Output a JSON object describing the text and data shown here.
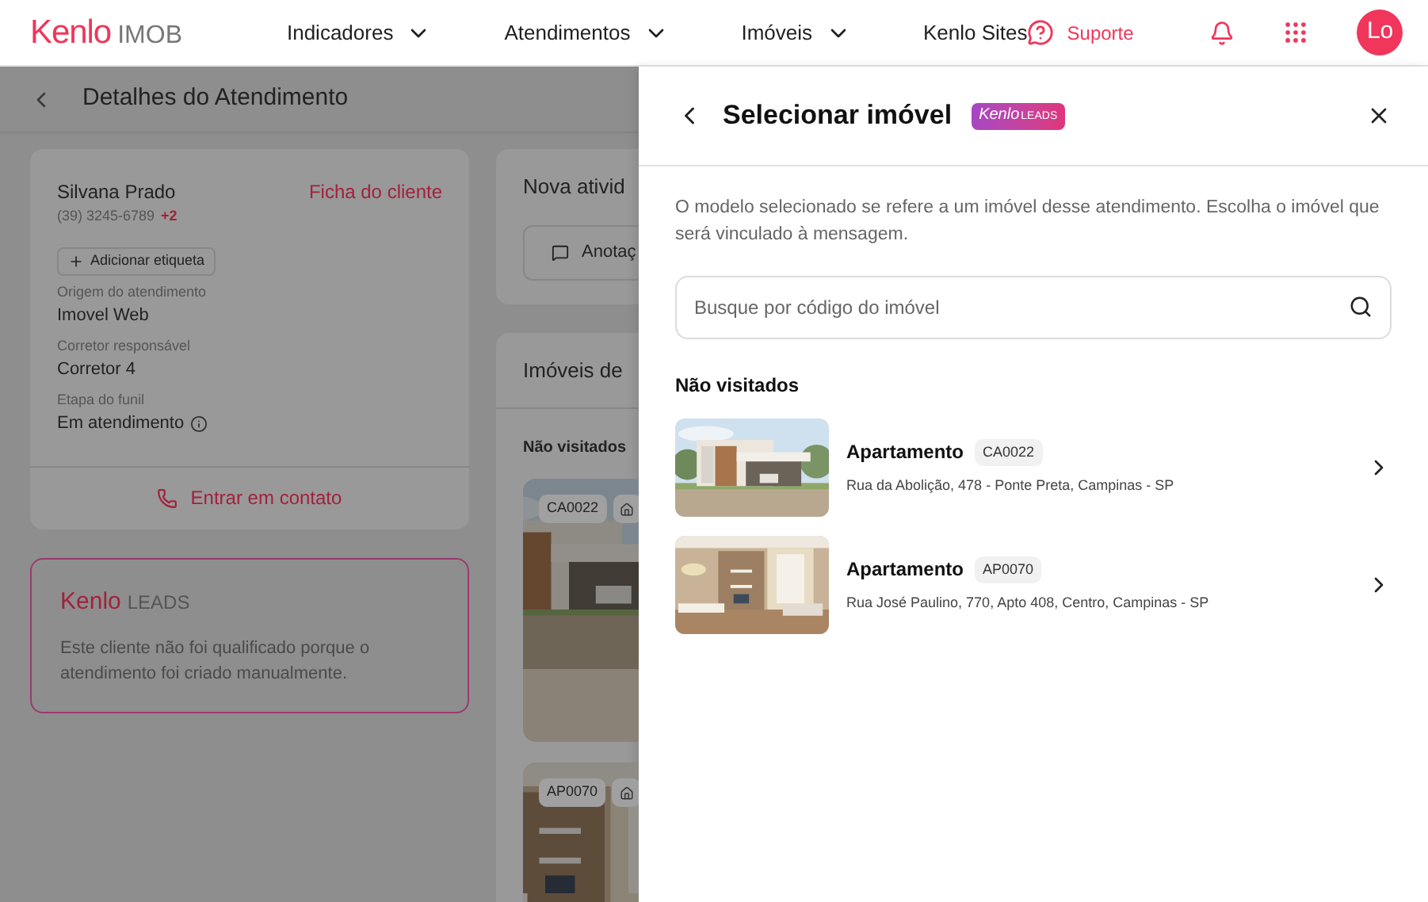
{
  "header": {
    "logo": {
      "brand": "Kenlo",
      "product": "IMOB"
    },
    "nav": [
      {
        "label": "Indicadores",
        "dropdown": true
      },
      {
        "label": "Atendimentos",
        "dropdown": true
      },
      {
        "label": "Imóveis",
        "dropdown": true
      },
      {
        "label": "Kenlo Sites",
        "dropdown": false
      }
    ],
    "support": "Suporte",
    "avatar": "Lo"
  },
  "page": {
    "title": "Detalhes do Atendimento",
    "client": {
      "name": "Silvana Prado",
      "phone": "(39) 3245-6789",
      "extra": "+2",
      "link": "Ficha do cliente",
      "tag_button": "Adicionar etiqueta",
      "fields": [
        {
          "label": "Origem do atendimento",
          "value": "Imovel Web",
          "info": false
        },
        {
          "label": "Corretor responsável",
          "value": "Corretor 4",
          "info": false
        },
        {
          "label": "Etapa do funil",
          "value": "Em atendimento",
          "info": true
        }
      ],
      "contact": "Entrar em contato"
    },
    "leads_card": {
      "brand": "Kenlo",
      "product": "LEADS",
      "text": "Este cliente não foi qualificado porque o atendimento foi criado manualmente."
    },
    "activity": {
      "title": "Nova ativid",
      "button": "Anotaç"
    },
    "properties": {
      "title": "Imóveis de",
      "section": "Não visitados",
      "cards": [
        {
          "code": "CA0022"
        },
        {
          "code": "AP0070"
        }
      ]
    }
  },
  "drawer": {
    "title": "Selecionar imóvel",
    "badge": {
      "brand": "Kenlo",
      "product": "LEADS"
    },
    "description": "O modelo selecionado se refere a um imóvel desse atendimento. Escolha o imóvel que será vinculado à mensagem.",
    "search": {
      "placeholder": "Busque por código do imóvel"
    },
    "section": "Não visitados",
    "items": [
      {
        "type": "Apartamento",
        "code": "CA0022",
        "address": "Rua da Abolição, 478 - Ponte Preta, Campinas - SP"
      },
      {
        "type": "Apartamento",
        "code": "AP0070",
        "address": "Rua José Paulino, 770, Apto 408, Centro, Campinas - SP"
      }
    ]
  }
}
